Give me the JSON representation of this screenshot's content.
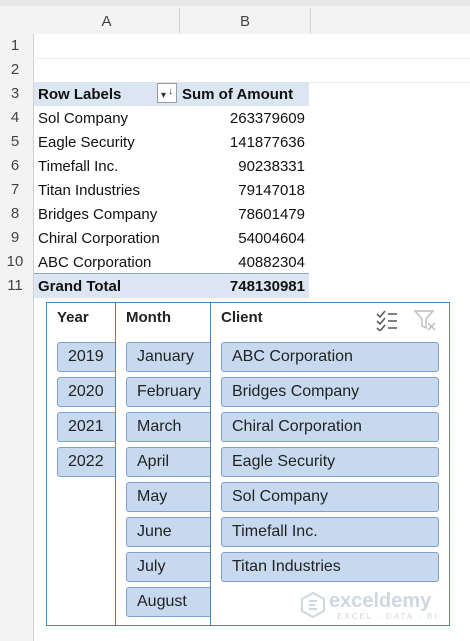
{
  "columns": [
    "A",
    "B"
  ],
  "row_numbers": [
    "1",
    "2",
    "3",
    "4",
    "5",
    "6",
    "7",
    "8",
    "9",
    "10",
    "11"
  ],
  "pivot": {
    "header_row_labels": "Row Labels",
    "header_sum": "Sum of Amount",
    "filter_icon": "sort-filter-dropdown-icon",
    "rows": [
      {
        "label": "Sol Company",
        "value": "263379609"
      },
      {
        "label": "Eagle Security",
        "value": "141877636"
      },
      {
        "label": "Timefall Inc.",
        "value": "90238331"
      },
      {
        "label": "Titan Industries",
        "value": "79147018"
      },
      {
        "label": "Bridges Company",
        "value": "78601479"
      },
      {
        "label": "Chiral Corporation",
        "value": "54004604"
      },
      {
        "label": "ABC Corporation",
        "value": "40882304"
      }
    ],
    "grand_total_label": "Grand Total",
    "grand_total_value": "748130981"
  },
  "slicers": {
    "year": {
      "title": "Year",
      "items": [
        "2019",
        "2020",
        "2021",
        "2022"
      ]
    },
    "month": {
      "title": "Month",
      "items": [
        "January",
        "February",
        "March",
        "April",
        "May",
        "June",
        "July",
        "August"
      ]
    },
    "client": {
      "title": "Client",
      "items": [
        "ABC Corporation",
        "Bridges Company",
        "Chiral Corporation",
        "Eagle Security",
        "Sol Company",
        "Timefall Inc.",
        "Titan Industries"
      ],
      "multi_select_icon": "multi-select-icon",
      "clear_filter_icon": "clear-filter-icon"
    }
  },
  "watermark": {
    "name": "exceldemy",
    "tagline": "EXCEL · DATA · BI"
  },
  "colors": {
    "slicer_border": "#4a86b8",
    "slicer_button": "#c6d9ee",
    "pivot_header_band": "#dce6f2"
  }
}
